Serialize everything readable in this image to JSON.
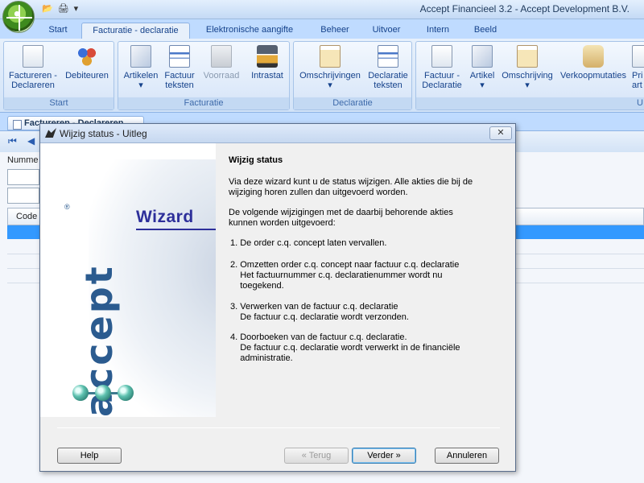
{
  "app": {
    "title": "Accept Financieel 3.2 - Accept Development B.V.",
    "qat_icons": [
      "folder-icon",
      "print-icon",
      "dropdown-icon"
    ],
    "qat_glyphs": [
      "📂",
      "🖨",
      "▾"
    ]
  },
  "tabs": [
    {
      "label": "Start",
      "active": false
    },
    {
      "label": "Facturatie - declaratie",
      "active": true
    },
    {
      "label": "Elektronische aangifte",
      "active": false
    },
    {
      "label": "Beheer",
      "active": false
    },
    {
      "label": "Uitvoer",
      "active": false
    },
    {
      "label": "Intern",
      "active": false
    },
    {
      "label": "Beeld",
      "active": false
    }
  ],
  "ribbon": {
    "groups": [
      {
        "label": "Start",
        "buttons": [
          {
            "line1": "Factureren -",
            "line2": "Declareren",
            "icon": "invoice-icon"
          },
          {
            "line1": "Debiteuren",
            "line2": "",
            "icon": "people-icon"
          }
        ]
      },
      {
        "label": "Facturatie",
        "buttons": [
          {
            "line1": "Artikelen",
            "line2": "▾",
            "icon": "articles-icon"
          },
          {
            "line1": "Factuur",
            "line2": "teksten",
            "icon": "text-document-icon"
          },
          {
            "line1": "Voorraad",
            "line2": "",
            "icon": "stock-icon",
            "disabled": true
          },
          {
            "line1": "Intrastat",
            "line2": "",
            "icon": "truck-icon"
          }
        ]
      },
      {
        "label": "Declaratie",
        "buttons": [
          {
            "line1": "Omschrijvingen",
            "line2": "▾",
            "icon": "clipboard-icon"
          },
          {
            "line1": "Declaratie",
            "line2": "teksten",
            "icon": "text-document-icon"
          }
        ]
      },
      {
        "label": "U",
        "buttons": [
          {
            "line1": "Factuur -",
            "line2": "Declaratie",
            "icon": "invoice-icon"
          },
          {
            "line1": "Artikel",
            "line2": "▾",
            "icon": "articles-icon"
          },
          {
            "line1": "Omschrijving",
            "line2": "▾",
            "icon": "clipboard-icon"
          },
          {
            "line1": "Verkoopmutaties",
            "line2": "",
            "icon": "scroll-icon"
          },
          {
            "line1": "Pri",
            "line2": "art",
            "icon": "print-icon"
          }
        ]
      }
    ]
  },
  "document": {
    "tab_label": "Factureren - Declareren",
    "labels": {
      "nummer": "Numme",
      "code": "Code"
    }
  },
  "dialog": {
    "title": "Wijzig status - Uitleg",
    "close_label": "✕",
    "side_word": "Wizard",
    "logo_text": "accept",
    "logo_reg": "®",
    "heading": "Wijzig status",
    "intro": [
      "Via deze wizard kunt u de status wijzigen. Alle akties die bij de",
      "wijziging horen zullen dan uitgevoerd worden."
    ],
    "intro2": [
      "De volgende wijzigingen met de daarbij behorende akties",
      "kunnen worden uitgevoerd:"
    ],
    "items": [
      [
        "1. De order c.q. concept laten vervallen."
      ],
      [
        "2. Omzetten order c.q. concept naar factuur c.q. declaratie",
        "    Het factuurnummer c.q. declaratienummer wordt nu",
        "    toegekend."
      ],
      [
        "3. Verwerken van de factuur c.q. declaratie",
        "    De factuur c.q. declaratie wordt verzonden."
      ],
      [
        "4. Doorboeken van de factuur c.q. declaratie.",
        "    De factuur c.q. declaratie wordt verwerkt in de financiële",
        "    administratie."
      ]
    ],
    "buttons": {
      "help": "Help",
      "back": "« Terug",
      "next": "Verder »",
      "cancel": "Annuleren"
    }
  }
}
